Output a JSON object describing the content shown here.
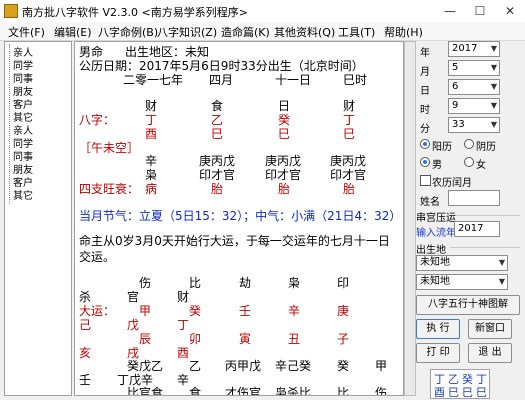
{
  "window": {
    "title": "南方批八字软件 V2.3.0  <南方易学系列程序>",
    "minimize": "—",
    "maximize": "☐",
    "close": "✕"
  },
  "menu": [
    "文件(F)",
    "编辑(E)",
    "八字命例(B)",
    "八字知识(Z)",
    "造命篇(K)",
    "其他资料(Q)",
    "工具(T)",
    "帮助(H)"
  ],
  "tree": [
    "亲人",
    "同学",
    "同事",
    "朋友",
    "客户",
    "其它",
    "亲人",
    "同学",
    "同事",
    "朋友",
    "客户",
    "其它"
  ],
  "chart": {
    "line1_a": "男命",
    "line1_b": "出生地区：未知",
    "line2": "公历日期：2017年5月6日9时33分出生（北京时间）",
    "year_cn": "二零一七年",
    "month_cn": "四月",
    "day_cn": "十一日",
    "hour_cn": "巳时",
    "shishen": [
      "财",
      "食",
      "日",
      "财"
    ],
    "bazi_label": "八字：",
    "gan": [
      "丁",
      "乙",
      "癸",
      "丁"
    ],
    "zhi": [
      "酉",
      "巳",
      "巳",
      "巳"
    ],
    "kongwang": "［午未空］",
    "cang_gan": [
      "辛",
      "庚丙戊",
      "庚丙戊",
      "庚丙戊"
    ],
    "cang_shen": [
      "枭",
      "印才官",
      "印才官",
      "印才官"
    ],
    "changsheng_label": "四支旺衰：",
    "changsheng": [
      "病",
      "胎",
      "胎",
      "胎"
    ],
    "jieqi": "当月节气：立夏（5日15：32）；中气：小满（21日4：32）",
    "dayun_intro": "命主从0岁3月0天开始行大运，于每一交运年的七月十一日交运。",
    "dy_shishen": [
      "伤",
      "比",
      "劫",
      "枭",
      "印"
    ],
    "dy_row1": [
      "杀",
      "官",
      "财"
    ],
    "dayun_label": "大运：",
    "dy_gan": [
      "甲",
      "癸",
      "壬",
      "辛",
      "庚"
    ],
    "dy_row_ji": "己",
    "dy_ji_shen": [
      "戊",
      "丁"
    ],
    "dy_zhi": [
      "辰",
      "卯",
      "寅",
      "丑",
      "子"
    ],
    "dy_row_hai": "亥",
    "dy_hai_shen": [
      "戌",
      "酉"
    ],
    "dy_cang": [
      "癸戊乙",
      "乙",
      "丙甲戊",
      "辛己癸",
      "癸",
      "甲"
    ],
    "dy_row_ren": "壬",
    "dy_ren_shen": [
      "丁戊辛",
      "辛"
    ],
    "dy_bottom": [
      "比官食",
      "食",
      "才伤官",
      "枭杀比",
      "比",
      "伤"
    ]
  },
  "form": {
    "year_label": "年",
    "year": "2017",
    "month_label": "月",
    "month": "5",
    "day_label": "日",
    "day": "6",
    "hour_label": "时",
    "hour": "9",
    "minute_label": "分",
    "minute": "33",
    "yang_label": "阳历",
    "yin_label": "阴历",
    "male_label": "男",
    "female_label": "女",
    "leap_label": "农历闰月",
    "name_label": "姓名",
    "name_value": "",
    "gong_label": "串宫压运",
    "liunian_label": "输入流年",
    "liunian_value": "2017",
    "birthplace_label": "出生地",
    "place1": "未知地",
    "place2": "未知地",
    "map_btn": "八字五行十神图解",
    "exec_btn": "执 行",
    "newwin_btn": "新窗口",
    "print_btn": "打 印",
    "exit_btn": "退 出",
    "bottom_gz_top": [
      "丁",
      "乙",
      "癸",
      "丁"
    ],
    "bottom_gz_bot": [
      "酉",
      "巳",
      "巳",
      "巳"
    ]
  }
}
